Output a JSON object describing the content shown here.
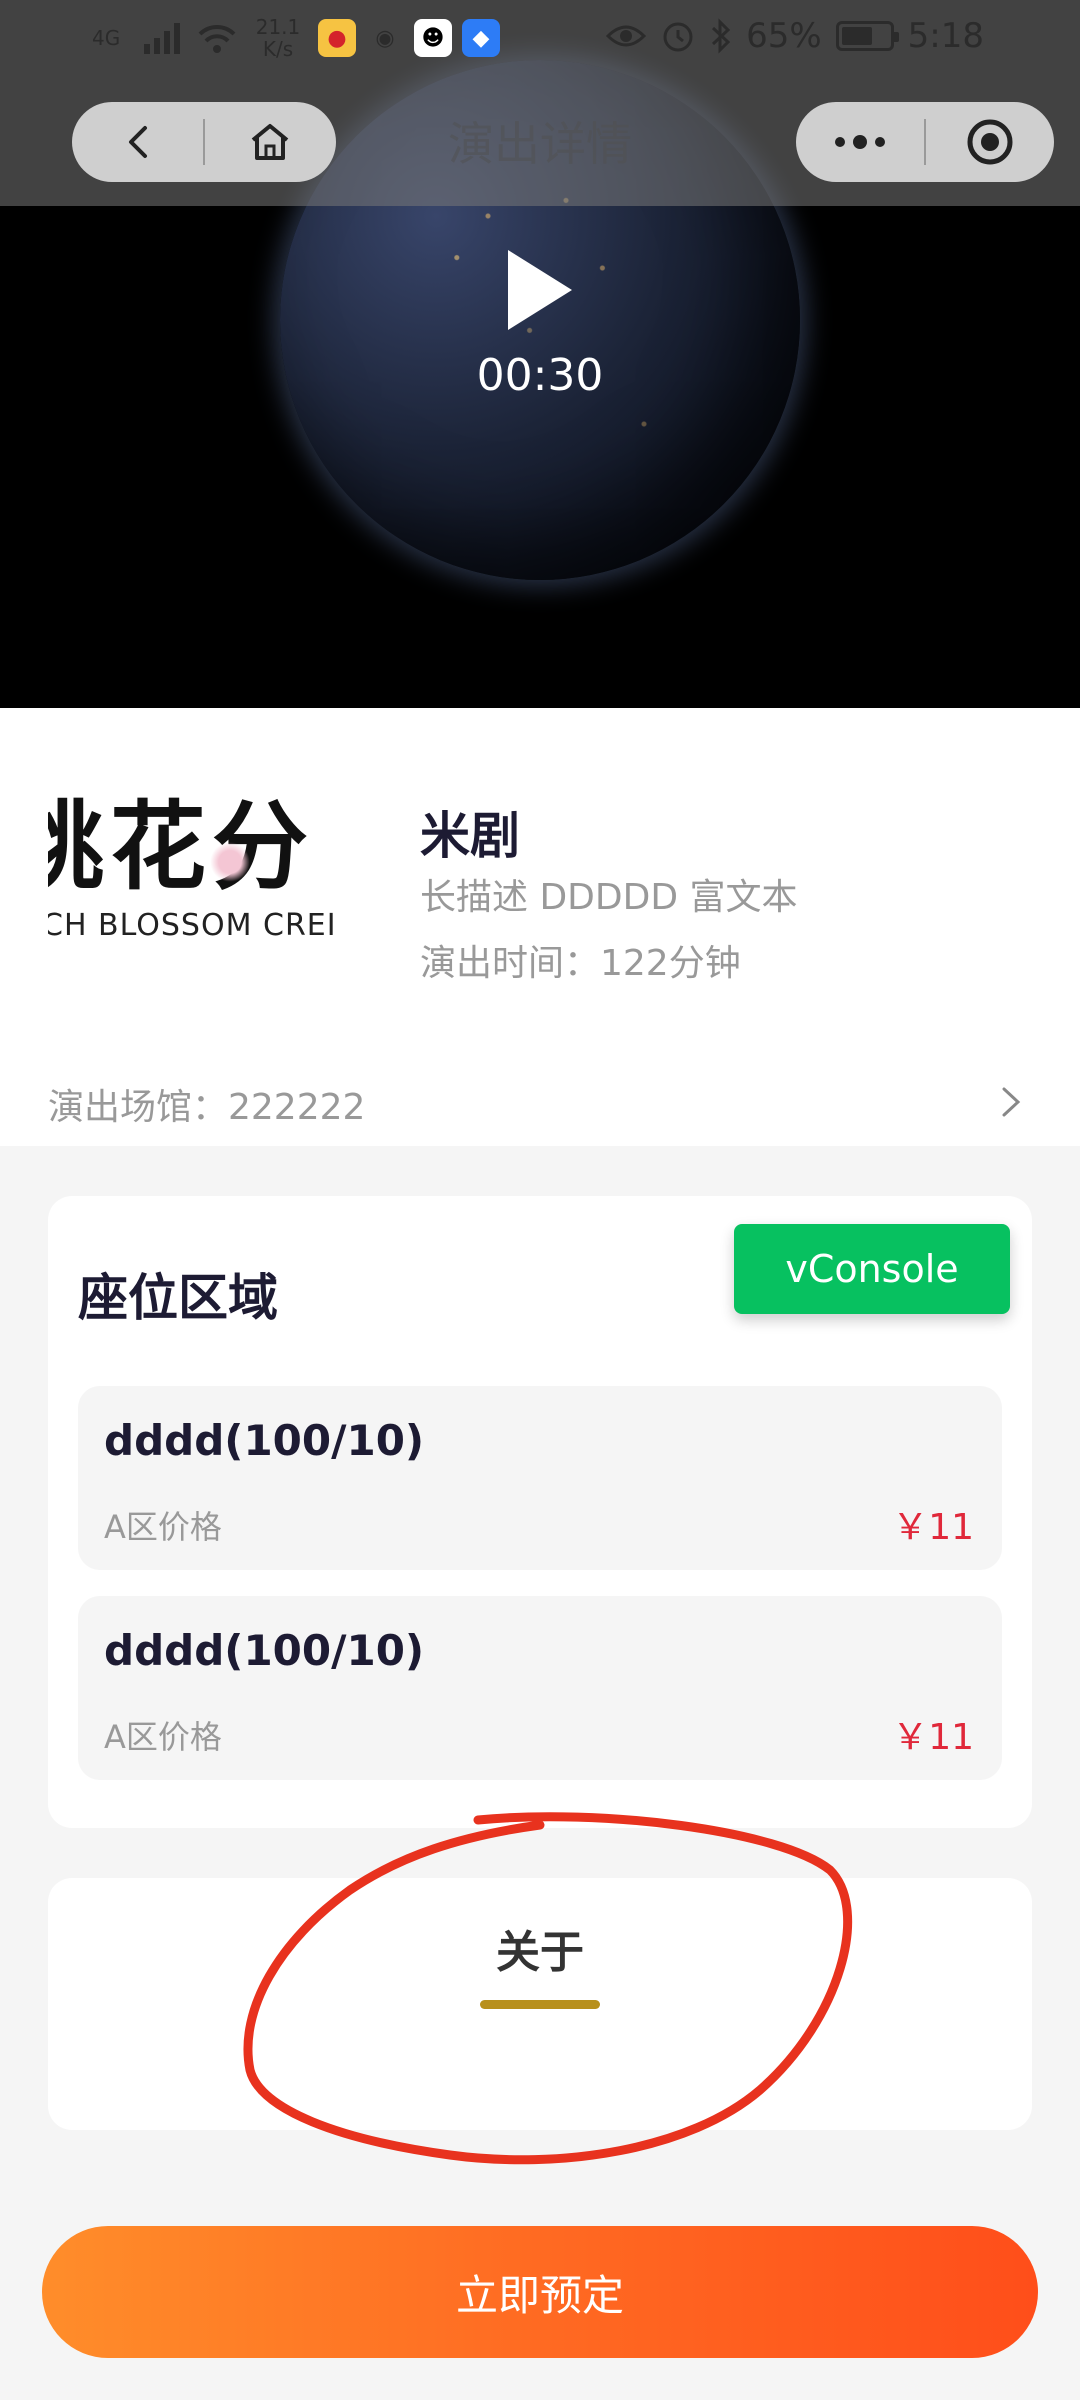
{
  "status_bar": {
    "network_label": "4G",
    "speed_value": "21.1",
    "speed_unit": "K/s",
    "battery_text": "65%",
    "battery_level": 0.65,
    "time": "5:18",
    "icons": [
      "signal-icon",
      "wifi-icon",
      "weibo-app-icon",
      "app-icon",
      "qq-app-icon",
      "car-app-icon",
      "eye-icon",
      "alarm-icon",
      "bluetooth-icon",
      "battery-icon"
    ]
  },
  "nav": {
    "title": "演出详情",
    "icons": [
      "back-icon",
      "home-icon",
      "more-icon",
      "target-icon"
    ]
  },
  "video": {
    "duration": "00:30"
  },
  "show": {
    "title": "米剧",
    "description": "长描述 DDDDD 富文本",
    "duration": "演出时间：122分钟",
    "poster_text": "桃花分",
    "poster_subtext": "CH BLOSSOM CREI",
    "venue": "演出场馆：222222"
  },
  "seats": {
    "title": "座位区域",
    "items": [
      {
        "name": "dddd(100/10)",
        "price_label": "A区价格",
        "price": "￥11"
      },
      {
        "name": "dddd(100/10)",
        "price_label": "A区价格",
        "price": "￥11"
      }
    ]
  },
  "vconsole_label": "vConsole",
  "about": {
    "tab_label": "关于"
  },
  "book_button": "立即预定",
  "colors": {
    "accent_orange": "#ff6a22",
    "price_red": "#e0283a",
    "vconsole_green": "#07c160",
    "tab_underline": "#b8901c",
    "annotation_red": "#e8321e"
  }
}
